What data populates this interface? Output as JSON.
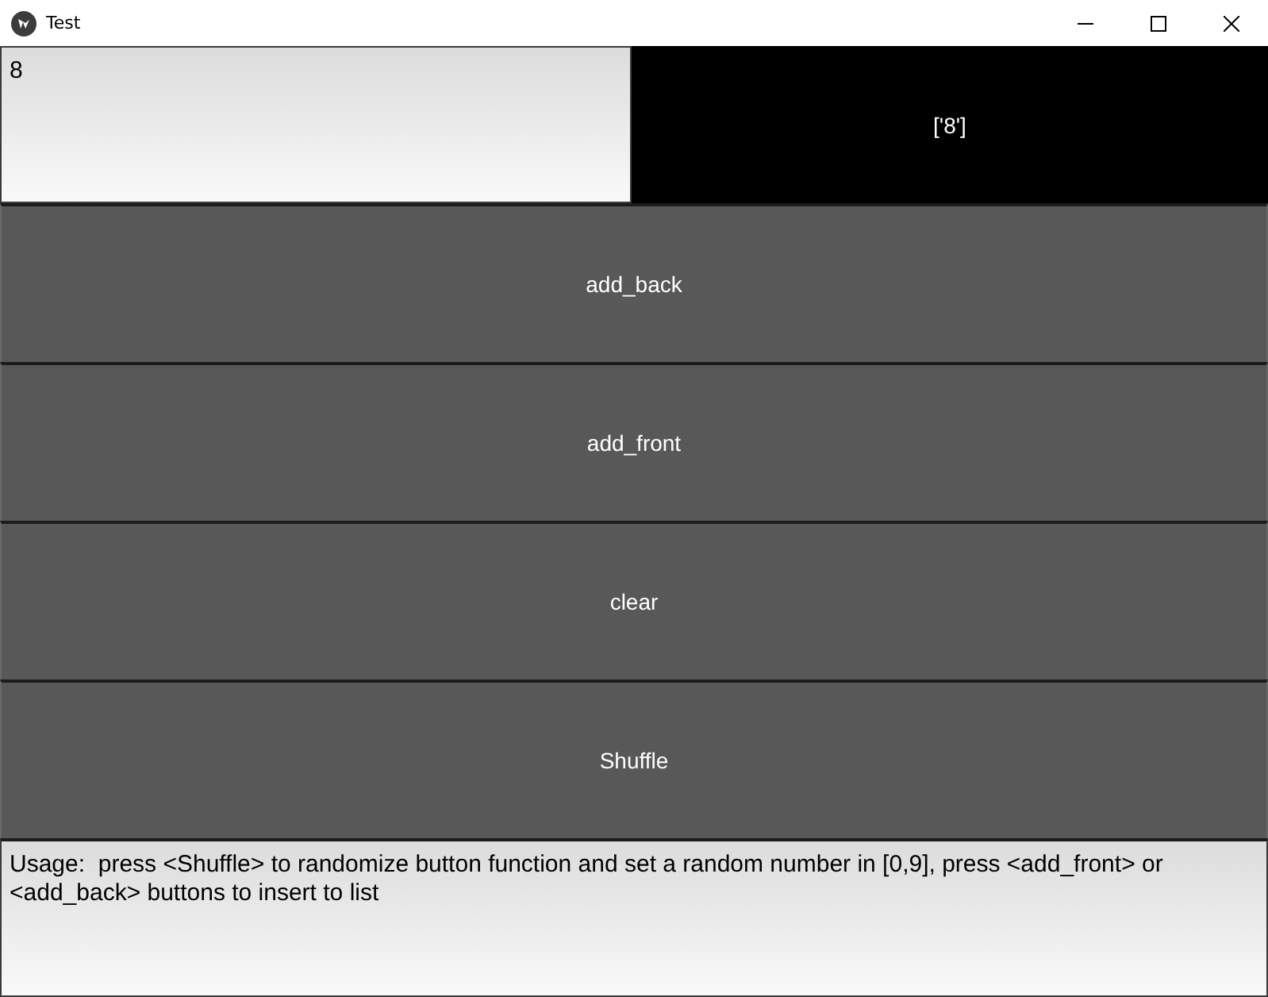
{
  "window": {
    "title": "Test"
  },
  "number_field": {
    "value": "8"
  },
  "list_display": {
    "text": "['8']"
  },
  "buttons": [
    "add_back",
    "add_front",
    "clear",
    "Shuffle"
  ],
  "usage_field": {
    "value": "Usage:  press <Shuffle> to randomize button function and set a random number in [0,9], press <add_front> or <add_back> buttons to insert to list"
  }
}
